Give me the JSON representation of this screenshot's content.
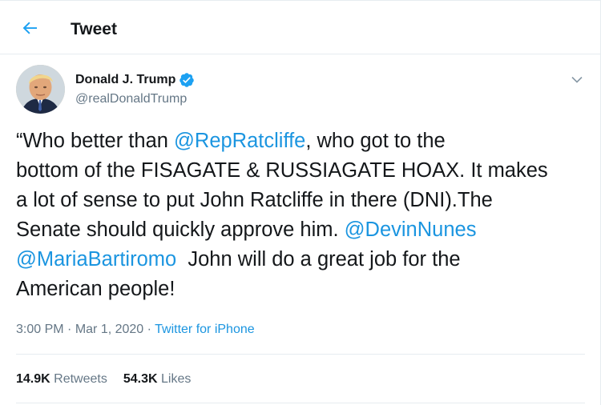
{
  "header": {
    "title": "Tweet",
    "back_icon": "arrow-left-icon"
  },
  "author": {
    "display_name": "Donald J. Trump",
    "handle": "@realDonaldTrump",
    "verified": true
  },
  "tweet": {
    "segments": [
      {
        "text": "“Who better than ",
        "mention": false
      },
      {
        "text": "@RepRatcliffe",
        "mention": true
      },
      {
        "text": ", who got to the\nbottom of the FISAGATE & RUSSIAGATE HOAX. It makes\na lot of sense to put John Ratcliffe in there (DNI).The\nSenate should quickly approve him. ",
        "mention": false
      },
      {
        "text": "@DevinNunes",
        "mention": true
      },
      {
        "text": "\n",
        "mention": false
      },
      {
        "text": "@MariaBartiromo",
        "mention": true
      },
      {
        "text": "  John will do a great job for the\nAmerican people!",
        "mention": false
      }
    ],
    "time": "3:00 PM",
    "date": "Mar 1, 2020",
    "separator": " · ",
    "source": "Twitter for iPhone"
  },
  "stats": {
    "retweets_count": "14.9K",
    "retweets_label": "Retweets",
    "likes_count": "54.3K",
    "likes_label": "Likes"
  },
  "colors": {
    "accent": "#1da1f2",
    "link": "#1b95e0",
    "secondary_text": "#657786",
    "border": "#e6ecf0"
  }
}
